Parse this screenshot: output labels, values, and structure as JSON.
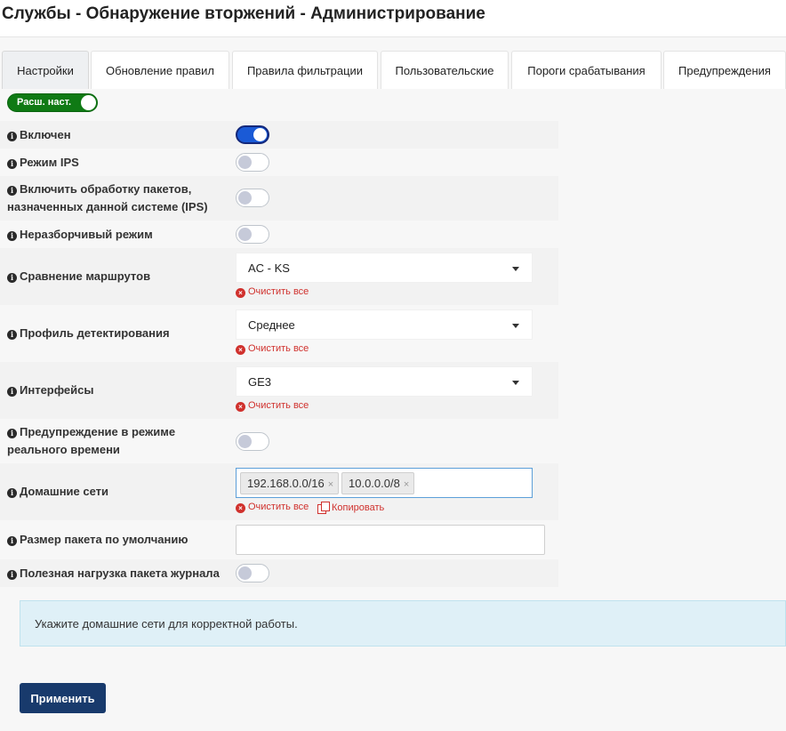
{
  "page": {
    "title": "Службы - Обнаружение вторжений - Администрирование"
  },
  "tabs": [
    {
      "label": "Настройки",
      "active": true
    },
    {
      "label": "Обновление правил",
      "active": false
    },
    {
      "label": "Правила фильтрации",
      "active": false
    },
    {
      "label": "Пользовательские",
      "active": false
    },
    {
      "label": "Пороги срабатывания",
      "active": false
    },
    {
      "label": "Предупреждения",
      "active": false
    }
  ],
  "advanced_toggle": {
    "label": "Расш. наст.",
    "on": true,
    "color": "#0f7a14"
  },
  "settings": {
    "enabled": {
      "line1": "Включен",
      "on": true
    },
    "ips_mode": {
      "line1": "Режим IPS",
      "on": false
    },
    "ips_own_packets": {
      "line1": "Включить обработку пакетов,",
      "line2": "назначенных данной системе (IPS)",
      "on": false
    },
    "promiscuous": {
      "line1": "Неразборчивый режим",
      "on": false
    },
    "pattern_matcher": {
      "line1": "Сравнение маршрутов",
      "value": "AC - KS"
    },
    "detect_profile": {
      "line1": "Профиль детектирования",
      "value": "Среднее"
    },
    "interfaces": {
      "line1": "Интерфейсы",
      "value": "GE3"
    },
    "realtime_alert": {
      "line1": "Предупреждение в режиме",
      "line2": "реального времени",
      "on": false
    },
    "home_networks": {
      "line1": "Домашние сети",
      "tags": [
        "192.168.0.0/16",
        "10.0.0.0/8"
      ],
      "tag_remove": "×"
    },
    "packet_size": {
      "line1": "Размер пакета по умолчанию",
      "value": ""
    },
    "log_payload": {
      "line1": "Полезная нагрузка пакета журнала",
      "on": false
    }
  },
  "common": {
    "clear_all": "Очистить все",
    "copy": "Копировать",
    "info_glyph": "i",
    "clear_glyph": "×"
  },
  "alert": {
    "text": "Укажите домашние сети для корректной работы."
  },
  "apply_button": {
    "label": "Применить",
    "color": "#183a6c"
  },
  "colors": {
    "switch_on": "#1a5ad6",
    "clear_link": "#d0312d",
    "alert_bg": "#dff0f7"
  }
}
